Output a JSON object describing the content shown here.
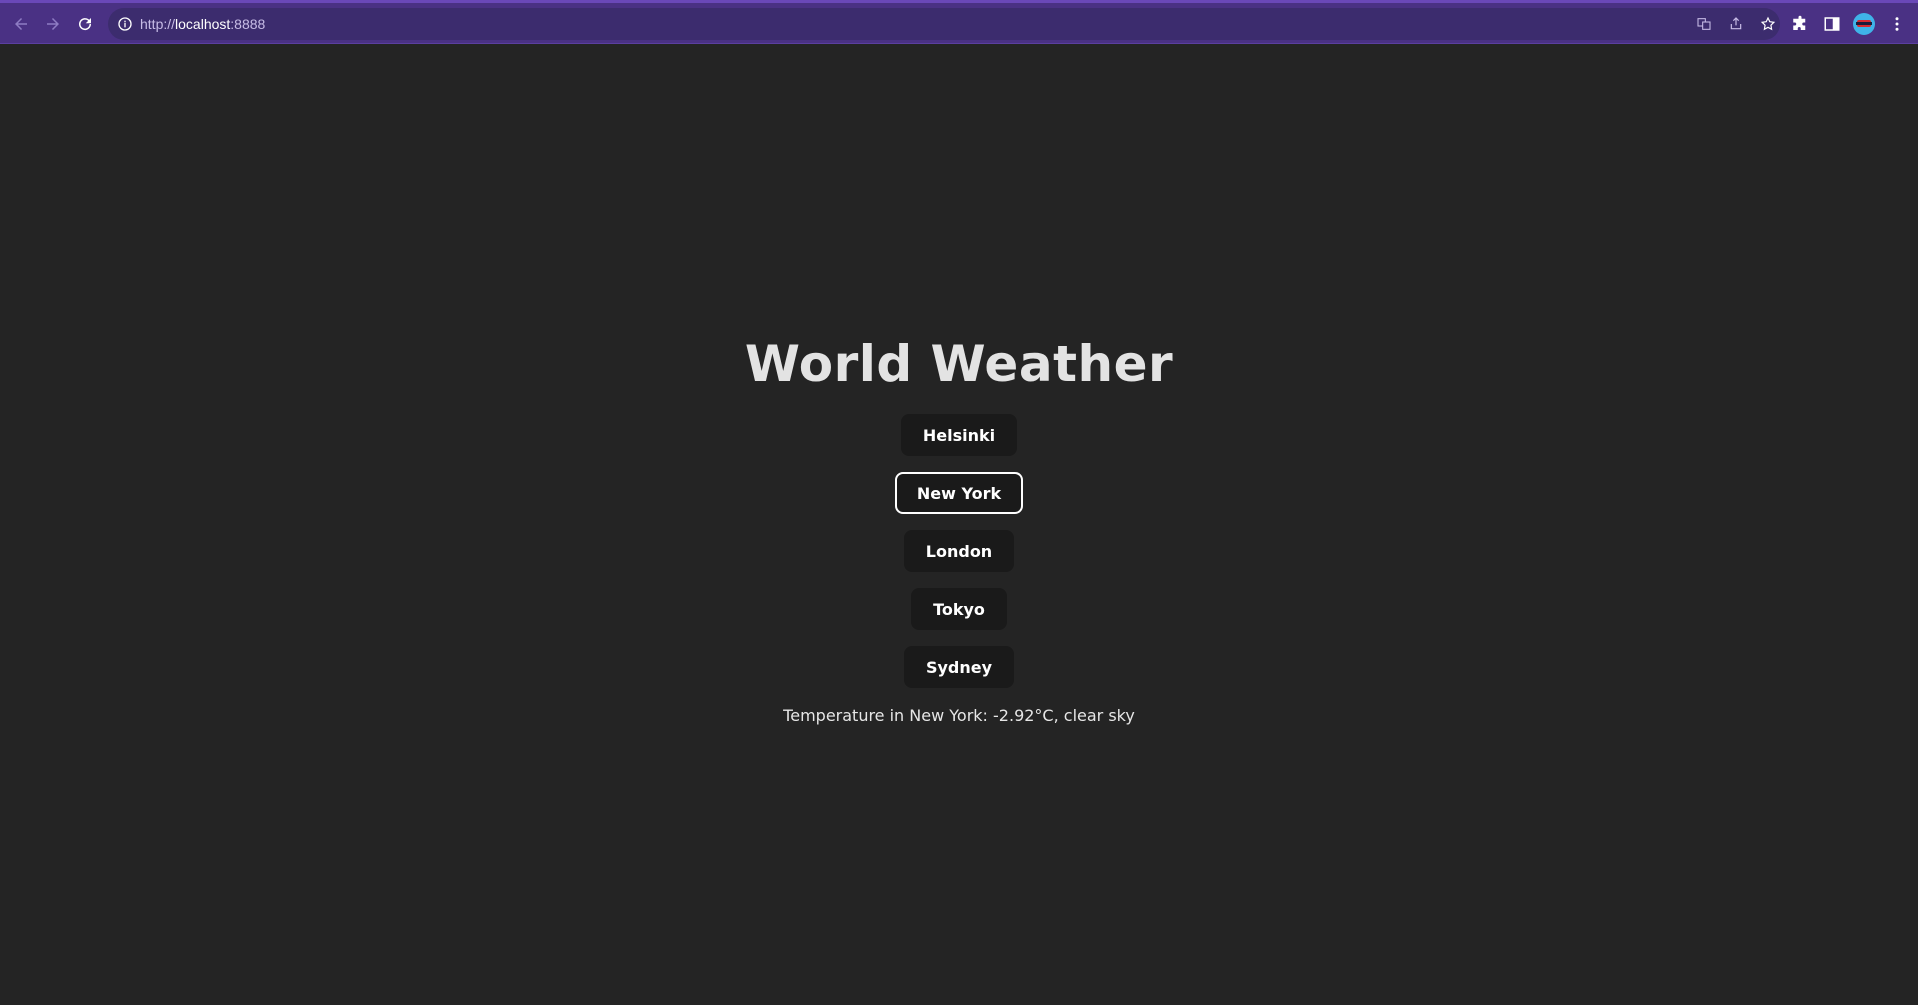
{
  "browser": {
    "url_scheme": "http://",
    "url_host": "localhost",
    "url_port": ":8888",
    "accent": "#4a3184"
  },
  "app": {
    "title": "World Weather",
    "cities": [
      "Helsinki",
      "New York",
      "London",
      "Tokyo",
      "Sydney"
    ],
    "selected_city": "New York",
    "result_text": "Temperature in New York: -2.92°C, clear sky"
  },
  "colors": {
    "background": "#242424",
    "button_bg": "#1a1a1a",
    "text": "#e3e3e3"
  }
}
